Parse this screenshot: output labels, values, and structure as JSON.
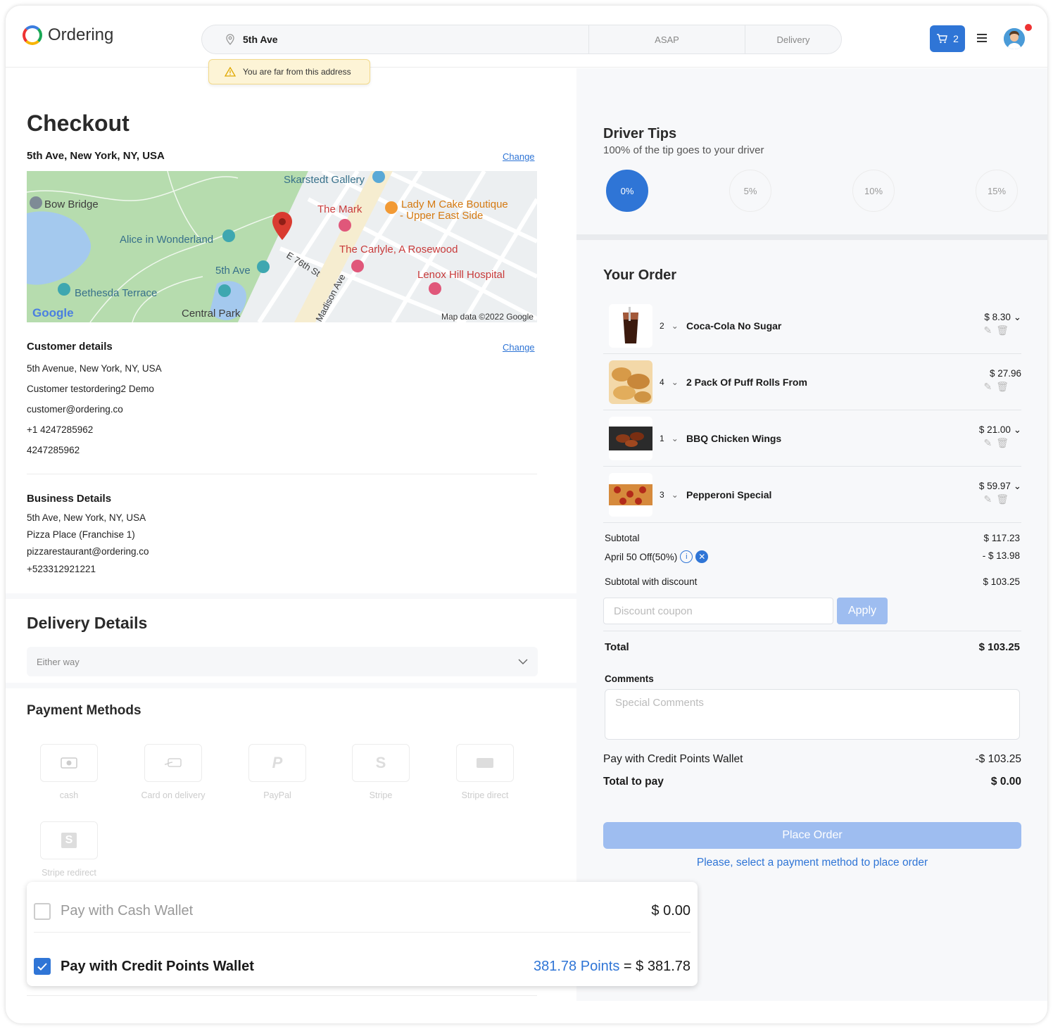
{
  "header": {
    "logo_text": "Ordering",
    "address": "5th Ave",
    "time": "ASAP",
    "mode": "Delivery",
    "cart_count": "2",
    "warning": "You are far from this address"
  },
  "checkout": {
    "title": "Checkout",
    "address": "5th Ave, New York, NY, USA",
    "change_label": "Change",
    "map": {
      "labels": [
        "Skarstedt Gallery",
        "Bow Bridge",
        "The Mark",
        "Lady M Cake Boutique",
        "- Upper East Side",
        "Alice in Wonderland",
        "The Carlyle, A Rosewood",
        "5th Ave",
        "E 76th St",
        "Lenox Hill Hospital",
        "Bethesda Terrace",
        "Madison Ave",
        "Central Park",
        "Google",
        "Map data ©2022 Google"
      ]
    },
    "customer": {
      "title": "Customer details",
      "change_label": "Change",
      "lines": [
        "5th Avenue, New York, NY, USA",
        "Customer testordering2 Demo",
        "customer@ordering.co",
        "+1 4247285962",
        "4247285962"
      ]
    },
    "business": {
      "title": "Business Details",
      "lines": [
        "5th Ave, New York, NY, USA",
        "Pizza Place (Franchise 1)",
        "pizzarestaurant@ordering.co",
        "+523312921221"
      ]
    },
    "delivery": {
      "title": "Delivery Details",
      "option": "Either way"
    },
    "payment": {
      "title": "Payment Methods",
      "methods": [
        {
          "label": "cash",
          "icon": "cash-icon"
        },
        {
          "label": "Card on delivery",
          "icon": "card-on-delivery-icon"
        },
        {
          "label": "PayPal",
          "icon": "paypal-icon"
        },
        {
          "label": "Stripe",
          "icon": "stripe-icon"
        },
        {
          "label": "Stripe direct",
          "icon": "stripe-direct-icon"
        },
        {
          "label": "Stripe redirect",
          "icon": "stripe-redirect-icon"
        }
      ]
    },
    "wallets": [
      {
        "label": "Pay with Cash Wallet",
        "checked": false,
        "amount": "$ 0.00"
      },
      {
        "label": "Pay with Credit Points Wallet",
        "checked": true,
        "points": "381.78 Points",
        "eq": "=",
        "amount": "$ 381.78"
      }
    ]
  },
  "tips": {
    "title": "Driver Tips",
    "subtitle": "100% of the tip goes to your driver",
    "options": [
      "0%",
      "5%",
      "10%",
      "15%"
    ],
    "selected": "0%"
  },
  "order": {
    "title": "Your Order",
    "items": [
      {
        "qty": "2",
        "name": "Coca-Cola No Sugar",
        "price": "$ 8.30",
        "thumb": "cola"
      },
      {
        "qty": "4",
        "name": "2 Pack Of Puff Rolls From",
        "price": "$ 27.96",
        "thumb": "rolls"
      },
      {
        "qty": "1",
        "name": "BBQ Chicken Wings",
        "price": "$ 21.00",
        "thumb": "wings"
      },
      {
        "qty": "3",
        "name": "Pepperoni Special",
        "price": "$ 59.97",
        "thumb": "pizza"
      }
    ],
    "subtotal_label": "Subtotal",
    "subtotal": "$ 117.23",
    "discount_label": "April 50 Off(50%)",
    "discount": "- $ 13.98",
    "subtotal_discount_label": "Subtotal with discount",
    "subtotal_discount": "$ 103.25",
    "coupon_placeholder": "Discount coupon",
    "apply_label": "Apply",
    "total_label": "Total",
    "total": "$ 103.25",
    "comments_label": "Comments",
    "comments_placeholder": "Special Comments",
    "wallet_label": "Pay with Credit Points Wallet",
    "wallet_amount": "-$ 103.25",
    "total_pay_label": "Total to pay",
    "total_pay": "$ 0.00",
    "place_label": "Place Order",
    "hint": "Please, select a payment method to place order"
  },
  "colors": {
    "accent": "#2f75d6",
    "accent_light": "#9ebdf0",
    "warning_bg": "#fdf4d6"
  }
}
